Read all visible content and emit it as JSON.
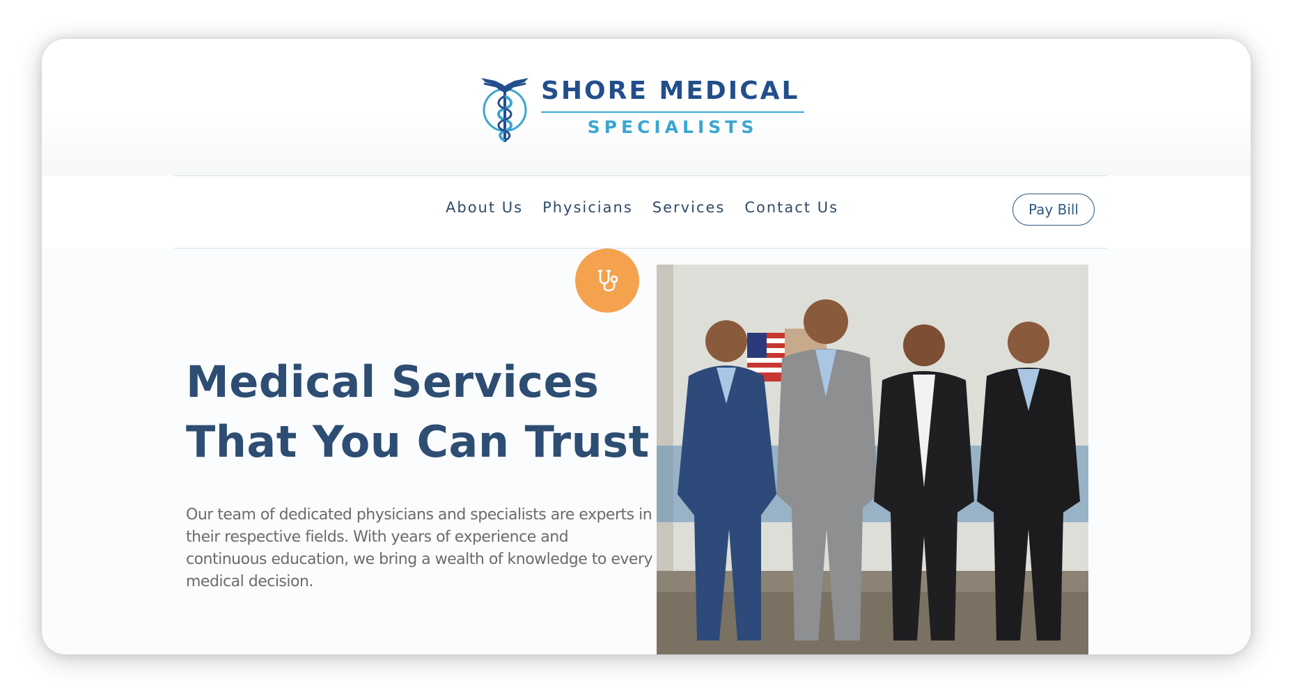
{
  "logo": {
    "name": "SHORE MEDICAL",
    "tagline": "SPECIALISTS"
  },
  "nav": {
    "items": [
      "About Us",
      "Physicians",
      "Services",
      "Contact Us"
    ],
    "pay_bill": "Pay Bill"
  },
  "hero": {
    "title_line1": "Medical Services",
    "title_line2": "That You Can Trust",
    "description": "Our team of dedicated physicians and specialists are experts in their respective fields. With years of experience and continuous education, we bring a wealth of knowledge to every medical decision.",
    "badge_icon": "stethoscope-icon",
    "photo_alt": "Four physicians standing together"
  },
  "colors": {
    "brand_navy": "#234e8c",
    "brand_cyan": "#3ba6d0",
    "accent_orange": "#f5a24e",
    "heading": "#2d4d73",
    "body_text": "#6b6b6b"
  }
}
